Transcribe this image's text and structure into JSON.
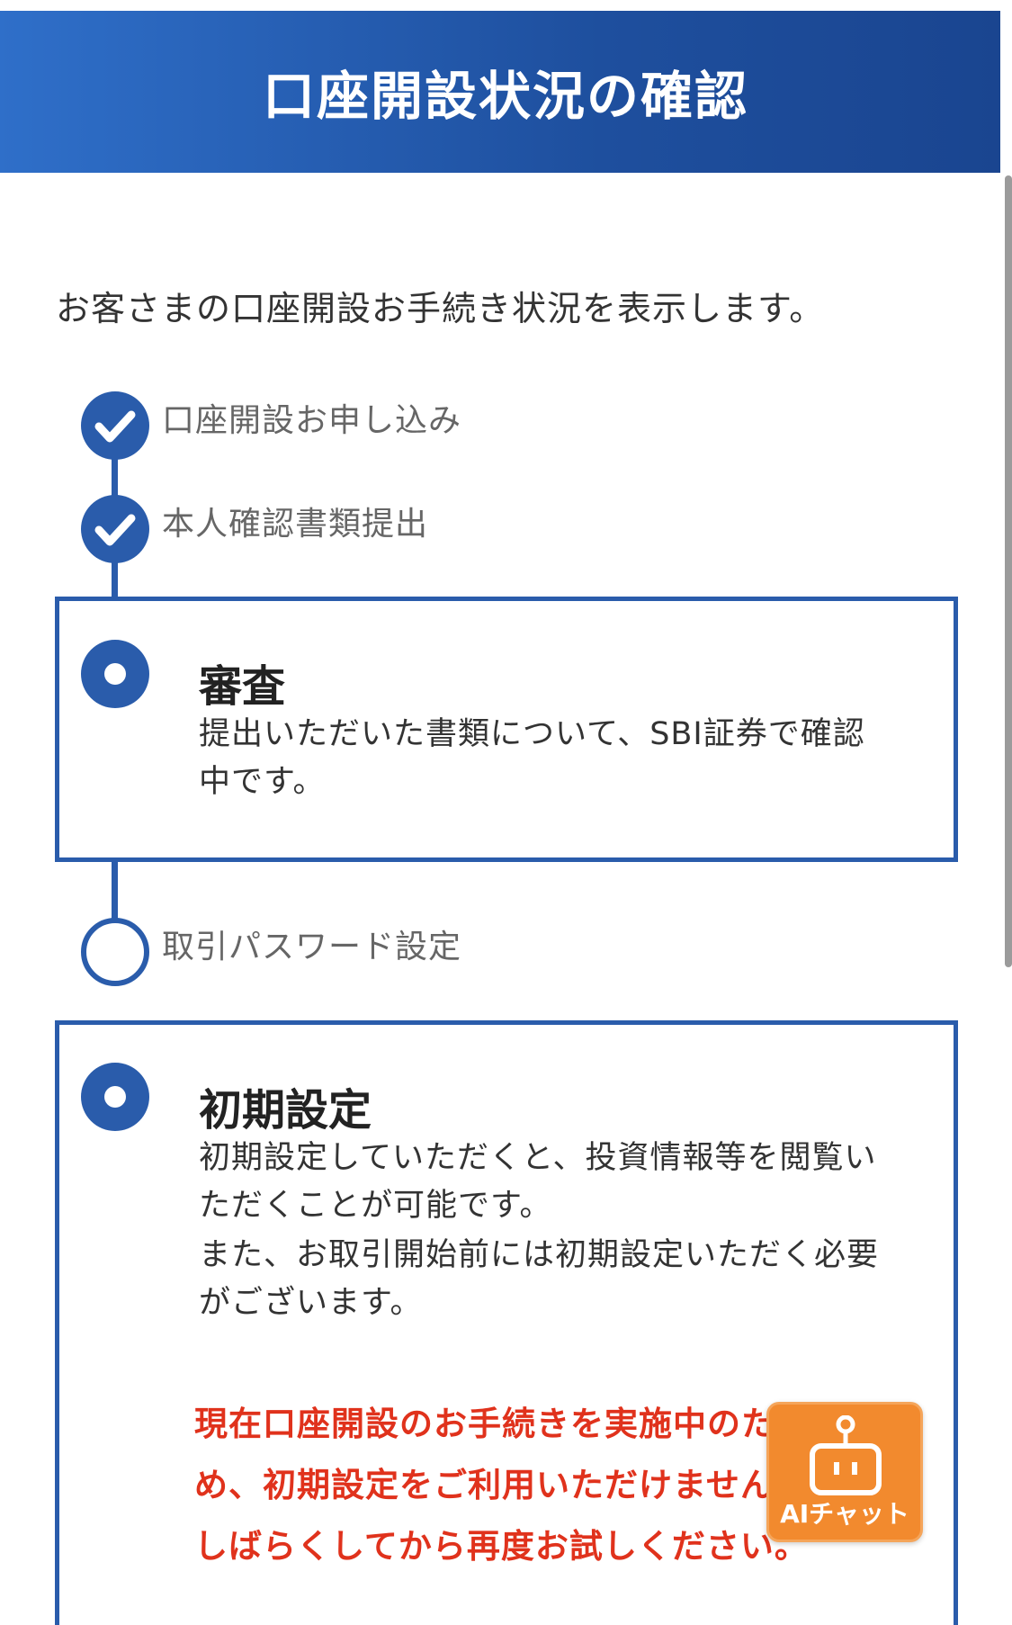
{
  "header": {
    "title": "口座開設状況の確認"
  },
  "intro": "お客さまの口座開設お手続き状況を表示します。",
  "steps": [
    {
      "label": "口座開設お申し込み",
      "status": "done"
    },
    {
      "label": "本人確認書類提出",
      "status": "done"
    },
    {
      "label": "審査",
      "status": "current",
      "description": "提出いただいた書類について、SBI証券で確認中です。"
    },
    {
      "label": "取引パスワード設定",
      "status": "pending"
    },
    {
      "label": "初期設定",
      "status": "current",
      "description_1": "初期設定していただくと、投資情報等を閲覧いただくことが可能です。",
      "description_2": "また、お取引開始前には初期設定いただく必要がございます。",
      "notice": "現在口座開設のお手続きを実施中のため、初期設定をご利用いただけません。しばらくしてから再度お試しください。"
    }
  ],
  "ai_chat": {
    "label": "AIチャット"
  },
  "colors": {
    "primary": "#2a5cab",
    "notice": "#e0321c",
    "ai_chat": "#f28a2e"
  }
}
